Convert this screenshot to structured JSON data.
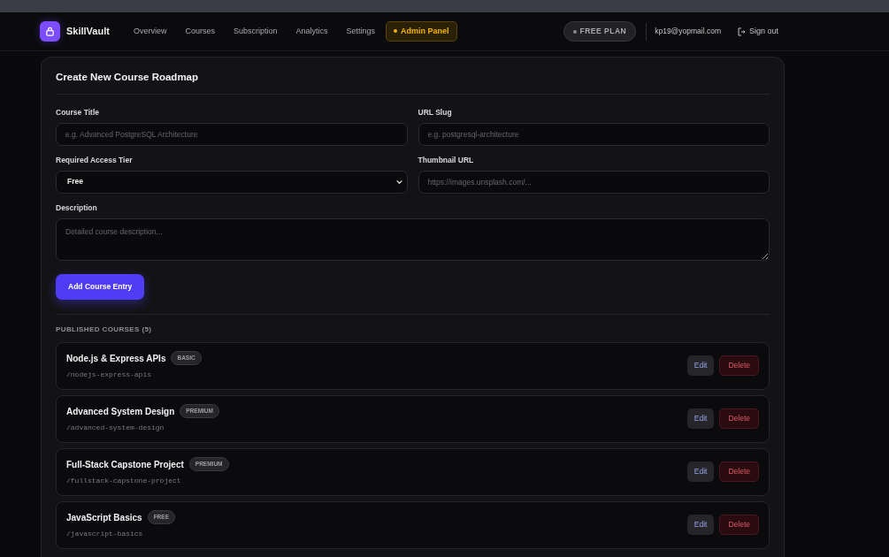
{
  "brand": {
    "name": "SkillVault"
  },
  "nav": [
    {
      "label": "Overview",
      "selected": false
    },
    {
      "label": "Courses",
      "selected": false
    },
    {
      "label": "Subscription",
      "selected": false
    },
    {
      "label": "Analytics",
      "selected": false
    },
    {
      "label": "Settings",
      "selected": false
    },
    {
      "label": "Admin Panel",
      "selected": true
    }
  ],
  "plan_badge": "FREE PLAN",
  "user_email": "kp19@yopmail.com",
  "sign_out": "Sign out",
  "form": {
    "title": "Create New Course Roadmap",
    "fields": [
      {
        "kind": "input",
        "label": "Course Title",
        "placeholder": "e.g. Advanced PostgreSQL Architecture"
      },
      {
        "kind": "input",
        "label": "URL Slug",
        "placeholder": "e.g. postgresql-architecture"
      },
      {
        "kind": "select",
        "label": "Required Access Tier",
        "value": "Free"
      },
      {
        "kind": "input",
        "label": "Thumbnail URL",
        "placeholder": "https://images.unsplash.com/..."
      },
      {
        "kind": "textarea",
        "label": "Description",
        "placeholder": "Detailed course description..."
      }
    ],
    "submit": "Add Course Entry"
  },
  "published": {
    "heading": "PUBLISHED COURSES (5)",
    "courses": [
      {
        "title": "Node.js & Express APIs",
        "tier": "BASIC",
        "slug": "/nodejs-express-apis",
        "edit": "Edit",
        "delete": "Delete"
      },
      {
        "title": "Advanced System Design",
        "tier": "PREMIUM",
        "slug": "/advanced-system-design",
        "edit": "Edit",
        "delete": "Delete"
      },
      {
        "title": "Full-Stack Capstone Project",
        "tier": "PREMIUM",
        "slug": "/fullstack-capstone-project",
        "edit": "Edit",
        "delete": "Delete"
      },
      {
        "title": "JavaScript Basics",
        "tier": "FREE",
        "slug": "/javascript-basics",
        "edit": "Edit",
        "delete": "Delete"
      }
    ]
  }
}
